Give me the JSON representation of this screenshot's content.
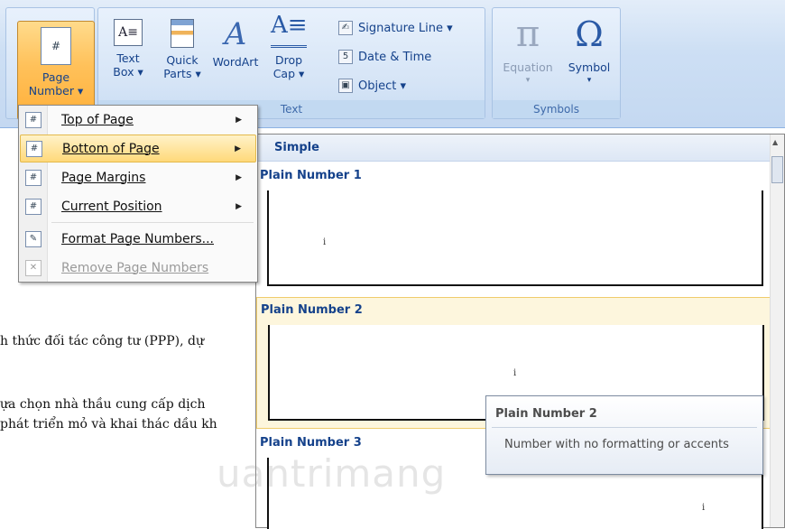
{
  "ribbon": {
    "page_number": {
      "line1": "Page",
      "line2": "Number ▾"
    },
    "text_box": {
      "line1": "Text",
      "line2": "Box ▾"
    },
    "quick_parts": {
      "line1": "Quick",
      "line2": "Parts ▾"
    },
    "wordart": {
      "line1": "WordArt"
    },
    "drop_cap": {
      "line1": "Drop",
      "line2": "Cap ▾"
    },
    "signature_line": "Signature Line ▾",
    "date_time": "Date & Time",
    "object": "Object ▾",
    "text_group": "Text",
    "equation": "Equation",
    "symbol": "Symbol",
    "symbols_group": "Symbols",
    "pi": "π",
    "omega": "Ω"
  },
  "menu": {
    "items": [
      {
        "label": "Top of Page",
        "has_submenu": true,
        "icon": "page-top-icon"
      },
      {
        "label": "Bottom of Page",
        "has_submenu": true,
        "icon": "page-bottom-icon",
        "highlighted": true
      },
      {
        "label": "Page Margins",
        "has_submenu": true,
        "icon": "page-margins-icon"
      },
      {
        "label": "Current Position",
        "has_submenu": true,
        "icon": "current-position-icon"
      },
      {
        "label": "Format Page Numbers...",
        "has_submenu": false,
        "icon": "format-page-numbers-icon"
      },
      {
        "label": "Remove Page Numbers",
        "has_submenu": false,
        "icon": "remove-page-numbers-icon",
        "disabled": true
      }
    ],
    "arrow": "▶"
  },
  "gallery": {
    "header": "Simple",
    "items": [
      {
        "title": "Plain Number 1",
        "num": "i"
      },
      {
        "title": "Plain Number 2",
        "num": "i"
      },
      {
        "title": "Plain Number 3",
        "num": "i"
      }
    ]
  },
  "tooltip": {
    "title": "Plain Number 2",
    "description": "Number with no formatting or accents"
  },
  "document": {
    "line1": "h thức đối tác công tư (PPP), dự",
    "line2": "ựa chọn nhà thầu cung cấp dịch",
    "line3": "phát triển mỏ và khai thác dầu kh"
  },
  "watermark": "uantrimang"
}
